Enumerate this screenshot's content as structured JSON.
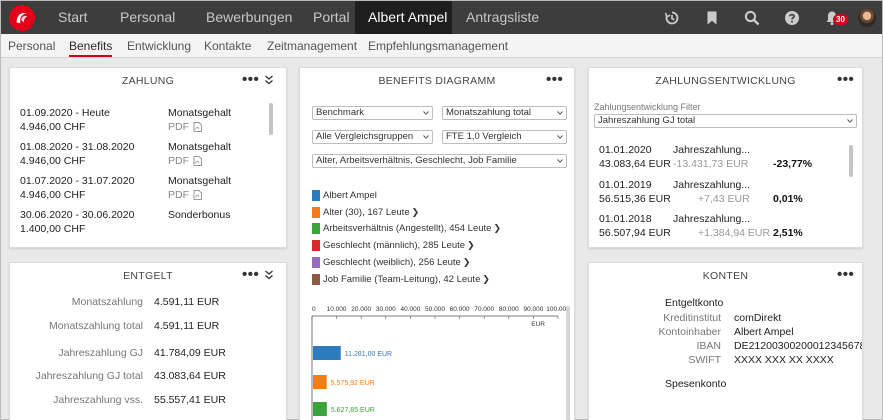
{
  "topnav": {
    "items": [
      {
        "label": "Start"
      },
      {
        "label": "Personal"
      },
      {
        "label": "Bewerbungen"
      },
      {
        "label": "Portal"
      },
      {
        "label": "Albert Ampel"
      },
      {
        "label": "Antragsliste"
      }
    ],
    "active_index": 4,
    "notifications_count": "30",
    "icons": [
      "history-icon",
      "bookmark-icon",
      "search-icon",
      "help-icon",
      "bell-icon",
      "avatar"
    ]
  },
  "subnav": {
    "items": [
      {
        "label": "Personal"
      },
      {
        "label": "Benefits"
      },
      {
        "label": "Entwicklung"
      },
      {
        "label": "Kontakte"
      },
      {
        "label": "Zeitmanagement"
      },
      {
        "label": "Empfehlungsmanagement"
      }
    ],
    "active_index": 1
  },
  "zahlung": {
    "title": "ZAHLUNG",
    "menu": "•••",
    "rows": [
      {
        "date": "01.09.2020 - Heute",
        "amount": "4.946,00 CHF",
        "type": "Monatsgehalt",
        "doc": "PDF"
      },
      {
        "date": "01.08.2020 - 31.08.2020",
        "amount": "4.946,00 CHF",
        "type": "Monatsgehalt",
        "doc": "PDF"
      },
      {
        "date": "01.07.2020 - 31.07.2020",
        "amount": "4.946,00 CHF",
        "type": "Monatsgehalt",
        "doc": "PDF"
      },
      {
        "date": "30.06.2020 - 30.06.2020",
        "amount": "1.400,00 CHF",
        "type": "Sonderbonus",
        "doc": ""
      }
    ]
  },
  "entgelt": {
    "title": "ENTGELT",
    "menu": "•••",
    "rows": [
      {
        "label": "Monatszahlung",
        "value": "4.591,11 EUR"
      },
      {
        "label": "Monatszahlung total",
        "value": "4.591,11 EUR"
      },
      {
        "label": "Jahreszahlung GJ",
        "value": "41.784,09 EUR"
      },
      {
        "label": "Jahreszahlung GJ total",
        "value": "43.083,64 EUR"
      },
      {
        "label": "Jahreszahlung vss.",
        "value": "55.557,41 EUR"
      }
    ]
  },
  "diagramm": {
    "title": "BENEFITS DIAGRAMM",
    "menu": "•••",
    "selects": [
      {
        "value": "Benchmark"
      },
      {
        "value": "Monatszahlung total"
      },
      {
        "value": "Alle Vergleichsgruppen"
      },
      {
        "value": "FTE 1,0 Vergleich"
      },
      {
        "value": "Alter, Arbeitsverhältnis, Geschlecht, Job Familie"
      }
    ],
    "legend": [
      {
        "label": "Albert Ampel",
        "color": "#2b7bbd",
        "arrow": ""
      },
      {
        "label": "Alter (30), 167 Leute",
        "color": "#f07d1a",
        "arrow": "❯"
      },
      {
        "label": "Arbeitsverhältnis (Angestellt), 454 Leute",
        "color": "#3aa33a",
        "arrow": "❯"
      },
      {
        "label": "Geschlecht (männlich), 285 Leute",
        "color": "#d42a2a",
        "arrow": "❯"
      },
      {
        "label": "Geschlecht (weiblich), 256 Leute",
        "color": "#9a6bbd",
        "arrow": "❯"
      },
      {
        "label": "Job Familie (Team-Leitung), 42 Leute",
        "color": "#8a5a44",
        "arrow": "❯"
      }
    ]
  },
  "chart_data": {
    "type": "bar",
    "orientation": "horizontal",
    "xlabel": "EUR",
    "xlim": [
      0,
      100000
    ],
    "ticks": [
      "0",
      "10.000",
      "20.000",
      "30.000",
      "40.000",
      "50.000",
      "60.000",
      "70.000",
      "80.000",
      "90.000",
      "100.000"
    ],
    "tick_values": [
      0,
      10000,
      20000,
      30000,
      40000,
      50000,
      60000,
      70000,
      80000,
      90000,
      100000
    ],
    "bars": [
      {
        "value": 11281,
        "label": "11.281,00 EUR",
        "color": "#2b7bbd"
      },
      {
        "value": 5575.92,
        "label": "5.575,92 EUR",
        "color": "#f07d1a"
      },
      {
        "value": 5627.85,
        "label": "5.627,85 EUR",
        "color": "#3aa33a"
      }
    ]
  },
  "zahlungsentwicklung": {
    "title": "ZAHLUNGSENTWICKLUNG",
    "menu": "•••",
    "filter_label": "Zahlungsentwicklung Filter",
    "filter_value": "Jahreszahlung GJ total",
    "rows": [
      {
        "date": "01.01.2020",
        "amount": "43.083,64 EUR",
        "type": "Jahreszahlung...",
        "delta": "-13.431,73 EUR",
        "pct": "-23,77%"
      },
      {
        "date": "01.01.2019",
        "amount": "56.515,36 EUR",
        "type": "Jahreszahlung...",
        "delta": "+7,43 EUR",
        "pct": "0,01%"
      },
      {
        "date": "01.01.2018",
        "amount": "56.507,94 EUR",
        "type": "Jahreszahlung...",
        "delta": "+1.384,94 EUR",
        "pct": "2,51%"
      }
    ]
  },
  "konten": {
    "title": "KONTEN",
    "menu": "•••",
    "section1": "Entgeltkonto",
    "rows": [
      {
        "label": "Kreditinstitut",
        "value": "comDirekt"
      },
      {
        "label": "Kontoinhaber",
        "value": "Albert Ampel"
      },
      {
        "label": "IBAN",
        "value": "DE21200300200012345678"
      },
      {
        "label": "SWIFT",
        "value": "XXXX XXX XX XXXX"
      }
    ],
    "section2": "Spesenkonto"
  }
}
